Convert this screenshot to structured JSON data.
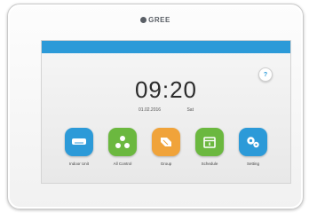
{
  "brand": {
    "name": "GREE"
  },
  "screen": {
    "help_symbol": "?",
    "time": "09:20",
    "date": "01.02.2016",
    "weekday": "Sat"
  },
  "apps": [
    {
      "label": "Indoor Unit",
      "icon": "indoor-unit-icon",
      "color": "#2c9ad8"
    },
    {
      "label": "All Control",
      "icon": "all-control-icon",
      "color": "#6bb83f"
    },
    {
      "label": "Group",
      "icon": "group-icon",
      "color": "#f0a33a"
    },
    {
      "label": "Schedule",
      "icon": "schedule-icon",
      "color": "#6bb83f"
    },
    {
      "label": "Setting",
      "icon": "setting-icon",
      "color": "#2c9ad8"
    }
  ],
  "colors": {
    "status_bar": "#2c9ad8",
    "bezel": "#ffffff"
  }
}
